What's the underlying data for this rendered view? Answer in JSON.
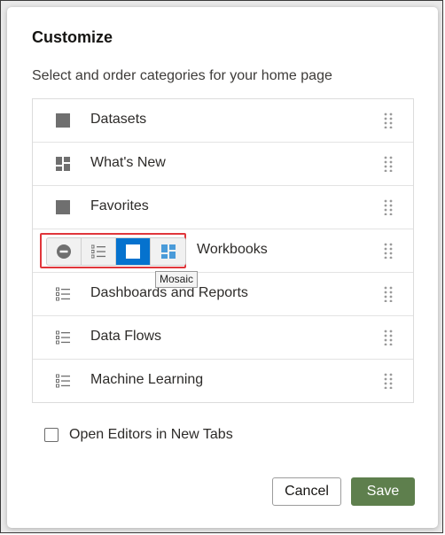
{
  "dialog": {
    "title": "Customize",
    "subtitle": "Select and order categories for your home page"
  },
  "categories": [
    {
      "label": "Datasets",
      "icon": "square-icon"
    },
    {
      "label": "What's New",
      "icon": "mosaic-icon"
    },
    {
      "label": "Favorites",
      "icon": "square-icon"
    },
    {
      "label": "Workbooks",
      "icon": "view-selector"
    },
    {
      "label": "Dashboards and Reports",
      "icon": "list-icon"
    },
    {
      "label": "Data Flows",
      "icon": "list-icon"
    },
    {
      "label": "Machine Learning",
      "icon": "list-icon"
    }
  ],
  "view_selector": {
    "options": [
      "hide",
      "list",
      "single",
      "mosaic"
    ],
    "selected": "single",
    "tooltip": "Mosaic"
  },
  "options": {
    "open_editors_label": "Open Editors in New Tabs",
    "open_editors_checked": false
  },
  "buttons": {
    "cancel": "Cancel",
    "save": "Save"
  },
  "colors": {
    "accent_blue": "#0572ce",
    "save_green": "#5e7f4d",
    "highlight_red": "#e0363b"
  }
}
